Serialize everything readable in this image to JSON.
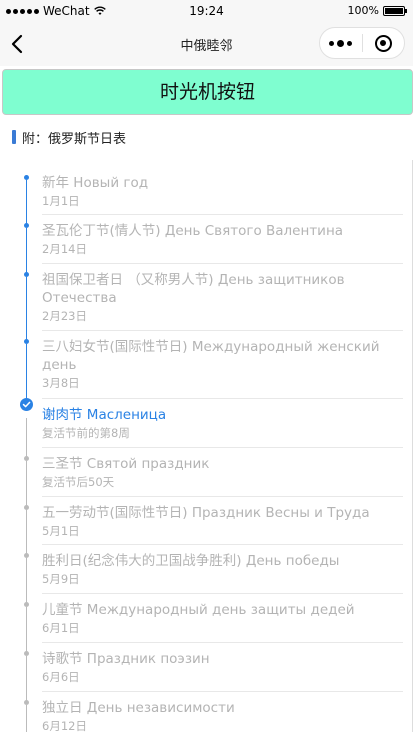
{
  "status_bar": {
    "carrier": "WeChat",
    "time": "19:24",
    "battery": "100%"
  },
  "nav": {
    "title": "中俄睦邻"
  },
  "tm_button": {
    "label": "时光机按钮"
  },
  "section": {
    "title": "附：俄罗斯节日表"
  },
  "colors": {
    "accent": "#2a82e4",
    "button_bg": "#7ffed0",
    "muted": "#b4b4b4"
  },
  "holidays": [
    {
      "name": "新年 Новый год",
      "date": "1月1日",
      "state": "past"
    },
    {
      "name": "圣瓦伦丁节(情人节) День Святого Валентина",
      "date": "2月14日",
      "state": "past"
    },
    {
      "name": "祖国保卫者日 （又称男人节) День защитников Отечества",
      "date": "2月23日",
      "state": "past"
    },
    {
      "name": "三八妇女节(国际性节日) Международный женский день",
      "date": "3月8日",
      "state": "past"
    },
    {
      "name": "谢肉节 Масленица",
      "date": "复活节前的第8周",
      "state": "current"
    },
    {
      "name": "三圣节 Святой праздник",
      "date": "复活节后50天",
      "state": "future"
    },
    {
      "name": "五一劳动节(国际性节日) Праздник Весны и Труда",
      "date": "5月1日",
      "state": "future"
    },
    {
      "name": "胜利日(纪念伟大的卫国战争胜利) День победы",
      "date": "5月9日",
      "state": "future"
    },
    {
      "name": "儿童节 Международный день защиты дедей",
      "date": "6月1日",
      "state": "future"
    },
    {
      "name": "诗歌节 Праздник поэзин",
      "date": "6月6日",
      "state": "future"
    },
    {
      "name": "独立日 День независимости",
      "date": "6月12日",
      "state": "future"
    }
  ]
}
